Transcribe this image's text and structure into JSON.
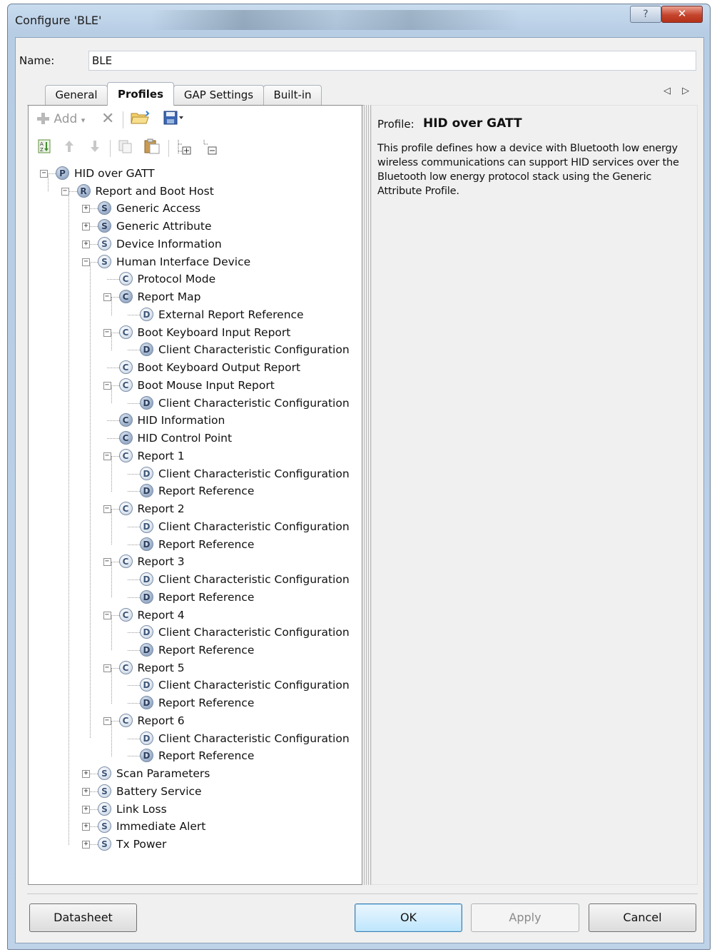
{
  "window": {
    "title": "Configure 'BLE'",
    "help": "?",
    "close": "✕"
  },
  "name": {
    "label": "Name:",
    "value": "BLE"
  },
  "tabs": [
    {
      "label": "General"
    },
    {
      "label": "Profiles"
    },
    {
      "label": "GAP Settings"
    },
    {
      "label": "Built-in"
    }
  ],
  "tab_scroll": "◁ ▷",
  "toolbar": {
    "add": "Add",
    "delete": "✕"
  },
  "tree": [
    {
      "label": "HID over GATT",
      "icon": "P",
      "level": 0,
      "expander": "minus",
      "dark": true
    },
    {
      "label": "Report and Boot Host",
      "icon": "R",
      "level": 1,
      "expander": "minus",
      "dark": true
    },
    {
      "label": "Generic Access",
      "icon": "S",
      "level": 2,
      "expander": "plus",
      "dark": true
    },
    {
      "label": "Generic Attribute",
      "icon": "S",
      "level": 2,
      "expander": "plus",
      "dark": true
    },
    {
      "label": "Device Information",
      "icon": "S",
      "level": 2,
      "expander": "plus",
      "dark": false
    },
    {
      "label": "Human Interface Device",
      "icon": "S",
      "level": 2,
      "expander": "minus",
      "dark": false
    },
    {
      "label": "Protocol Mode",
      "icon": "C",
      "level": 3,
      "expander": "none",
      "dark": false
    },
    {
      "label": "Report Map",
      "icon": "C",
      "level": 3,
      "expander": "minus",
      "dark": true
    },
    {
      "label": "External Report Reference",
      "icon": "D",
      "level": 4,
      "expander": "none",
      "dark": false
    },
    {
      "label": "Boot Keyboard Input Report",
      "icon": "C",
      "level": 3,
      "expander": "minus",
      "dark": false
    },
    {
      "label": "Client Characteristic Configuration",
      "icon": "D",
      "level": 4,
      "expander": "none",
      "dark": true
    },
    {
      "label": "Boot Keyboard Output Report",
      "icon": "C",
      "level": 3,
      "expander": "none",
      "dark": false
    },
    {
      "label": "Boot Mouse Input Report",
      "icon": "C",
      "level": 3,
      "expander": "minus",
      "dark": false
    },
    {
      "label": "Client Characteristic Configuration",
      "icon": "D",
      "level": 4,
      "expander": "none",
      "dark": true
    },
    {
      "label": "HID Information",
      "icon": "C",
      "level": 3,
      "expander": "none",
      "dark": true
    },
    {
      "label": "HID Control Point",
      "icon": "C",
      "level": 3,
      "expander": "none",
      "dark": true
    },
    {
      "label": "Report 1",
      "icon": "C",
      "level": 3,
      "expander": "minus",
      "dark": false
    },
    {
      "label": "Client Characteristic Configuration",
      "icon": "D",
      "level": 4,
      "expander": "none",
      "dark": false
    },
    {
      "label": "Report Reference",
      "icon": "D",
      "level": 4,
      "expander": "none",
      "dark": true
    },
    {
      "label": "Report 2",
      "icon": "C",
      "level": 3,
      "expander": "minus",
      "dark": false
    },
    {
      "label": "Client Characteristic Configuration",
      "icon": "D",
      "level": 4,
      "expander": "none",
      "dark": false
    },
    {
      "label": "Report Reference",
      "icon": "D",
      "level": 4,
      "expander": "none",
      "dark": true
    },
    {
      "label": "Report 3",
      "icon": "C",
      "level": 3,
      "expander": "minus",
      "dark": false
    },
    {
      "label": "Client Characteristic Configuration",
      "icon": "D",
      "level": 4,
      "expander": "none",
      "dark": false
    },
    {
      "label": "Report Reference",
      "icon": "D",
      "level": 4,
      "expander": "none",
      "dark": true
    },
    {
      "label": "Report 4",
      "icon": "C",
      "level": 3,
      "expander": "minus",
      "dark": false
    },
    {
      "label": "Client Characteristic Configuration",
      "icon": "D",
      "level": 4,
      "expander": "none",
      "dark": false
    },
    {
      "label": "Report Reference",
      "icon": "D",
      "level": 4,
      "expander": "none",
      "dark": true
    },
    {
      "label": "Report 5",
      "icon": "C",
      "level": 3,
      "expander": "minus",
      "dark": false
    },
    {
      "label": "Client Characteristic Configuration",
      "icon": "D",
      "level": 4,
      "expander": "none",
      "dark": false
    },
    {
      "label": "Report Reference",
      "icon": "D",
      "level": 4,
      "expander": "none",
      "dark": true
    },
    {
      "label": "Report 6",
      "icon": "C",
      "level": 3,
      "expander": "minus",
      "dark": false
    },
    {
      "label": "Client Characteristic Configuration",
      "icon": "D",
      "level": 4,
      "expander": "none",
      "dark": false
    },
    {
      "label": "Report Reference",
      "icon": "D",
      "level": 4,
      "expander": "none",
      "dark": true
    },
    {
      "label": "Scan Parameters",
      "icon": "S",
      "level": 2,
      "expander": "plus",
      "dark": false
    },
    {
      "label": "Battery Service",
      "icon": "S",
      "level": 2,
      "expander": "plus",
      "dark": false
    },
    {
      "label": "Link Loss",
      "icon": "S",
      "level": 2,
      "expander": "plus",
      "dark": false
    },
    {
      "label": "Immediate Alert",
      "icon": "S",
      "level": 2,
      "expander": "plus",
      "dark": false
    },
    {
      "label": "Tx Power",
      "icon": "S",
      "level": 2,
      "expander": "plus",
      "dark": false
    }
  ],
  "detail": {
    "profile_label": "Profile:",
    "profile_name": "HID over GATT",
    "description": "This profile defines how a device with Bluetooth low energy wireless communications can support HID services over the Bluetooth low energy protocol stack using the Generic Attribute Profile."
  },
  "buttons": {
    "datasheet": "Datasheet",
    "ok": "OK",
    "apply": "Apply",
    "cancel": "Cancel"
  }
}
